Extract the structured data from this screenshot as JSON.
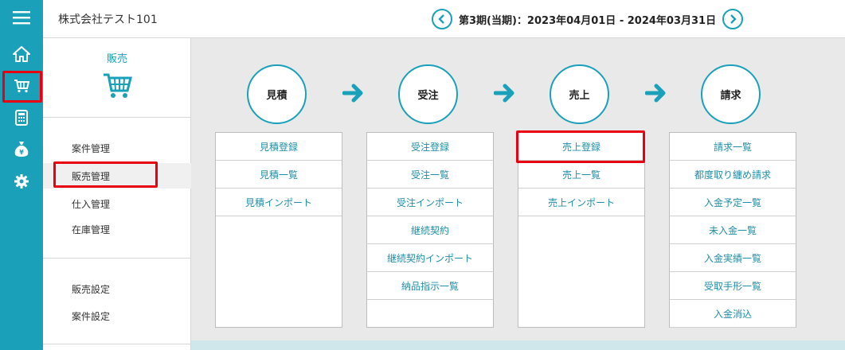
{
  "header": {
    "company": "株式会社テスト101",
    "period": "第3期(当期)：2023年04月01日 - 2024年03月31日"
  },
  "rail": {
    "items": [
      {
        "icon": "menu-icon"
      },
      {
        "icon": "home-icon"
      },
      {
        "icon": "cart-icon"
      },
      {
        "icon": "calculator-icon"
      },
      {
        "icon": "money-bag-icon"
      },
      {
        "icon": "gear-icon"
      }
    ]
  },
  "sidebar": {
    "title": "販売",
    "icon": "cart-icon",
    "group1": [
      {
        "label": "案件管理"
      },
      {
        "label": "販売管理",
        "active": true
      },
      {
        "label": "仕入管理"
      },
      {
        "label": "在庫管理"
      }
    ],
    "group2": [
      {
        "label": "販売設定"
      },
      {
        "label": "案件設定"
      }
    ]
  },
  "flow": {
    "steps": [
      {
        "label": "見積",
        "items": [
          "見積登録",
          "見積一覧",
          "見積インポート"
        ]
      },
      {
        "label": "受注",
        "items": [
          "受注登録",
          "受注一覧",
          "受注インポート",
          "継続契約",
          "継続契約インポート",
          "納品指示一覧"
        ]
      },
      {
        "label": "売上",
        "items": [
          "売上登録",
          "売上一覧",
          "売上インポート"
        ]
      },
      {
        "label": "請求",
        "items": [
          "請求一覧",
          "都度取り纏め請求",
          "入金予定一覧",
          "未入金一覧",
          "入金実績一覧",
          "受取手形一覧",
          "入金消込"
        ]
      }
    ]
  },
  "colors": {
    "accent": "#1aa0b9",
    "highlight": "#e60012",
    "link": "#1e8ea8"
  }
}
